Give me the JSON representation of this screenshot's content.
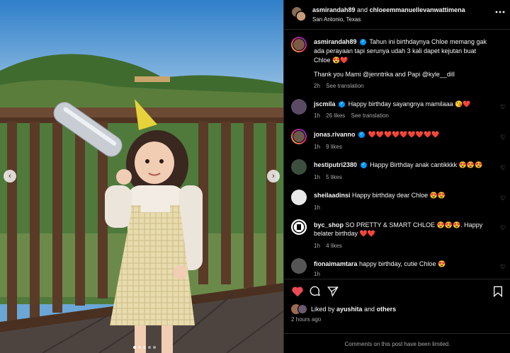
{
  "header": {
    "usernames_prefix": "asmirandah89",
    "usernames_connector": " and ",
    "usernames_suffix": "chloeemmanuellevanwattimena",
    "location": "San Antonio, Texas",
    "more_icon": "more-icon"
  },
  "caption": {
    "username": "asmirandah89",
    "line1": "Tahun ini birthdaynya Chloe memang gak",
    "line2": "ada perayaan tapi serunya udah 3 kali dapet kejutan buat",
    "line3": "Chloe 😍❤️",
    "line4": "Thank you Mami @jenntrika and Papi @kyle__dill",
    "time": "2h",
    "translate": "See translation"
  },
  "comments": [
    {
      "username": "jscmila",
      "verified": true,
      "text": "Happy birthday sayangnya mamilaaa 😘❤️",
      "time": "1h",
      "likes": "26 likes",
      "translate": "See translation"
    },
    {
      "username": "jonas.rivanno",
      "verified": true,
      "text": "❤️❤️❤️❤️❤️❤️❤️❤️❤️",
      "time": "1h",
      "likes": "9 likes",
      "translate": ""
    },
    {
      "username": "hestiputri2380",
      "verified": true,
      "text": "Happy Birthday anak cantikkkk 😍😍😍",
      "time": "1h",
      "likes": "5 likes",
      "translate": ""
    },
    {
      "username": "sheilaadinsi",
      "verified": false,
      "text": "Happy birthday dear Chloe 😍😍",
      "time": "1h",
      "likes": "",
      "translate": ""
    },
    {
      "username": "byc_shop",
      "verified": false,
      "text": "SO PRETTY & SMART CHLOE 😍😍😍. Happy",
      "text2": "belater birthday ❤️❤️",
      "time": "1h",
      "likes": "4 likes",
      "translate": ""
    },
    {
      "username": "fionaimamtara",
      "verified": false,
      "text": "happy birthday, cutie Chloe 😍",
      "time": "1h",
      "likes": "",
      "translate": ""
    }
  ],
  "actions": {
    "liked_by_prefix": "Liked by ",
    "liked_by_user": "ayushita",
    "liked_by_suffix": " and ",
    "liked_by_others": "others",
    "timestamp": "2 hours ago"
  },
  "footer": {
    "notice": "Comments on this post have been limited."
  },
  "carousel": {
    "prev_icon": "chevron-left-icon",
    "next_icon": "chevron-right-icon",
    "prev_glyph": "‹",
    "next_glyph": "›"
  },
  "colors": {
    "like_red": "#ed4956",
    "verified_blue": "#0095f6",
    "muted": "#a8a8a8",
    "border": "#262626"
  }
}
